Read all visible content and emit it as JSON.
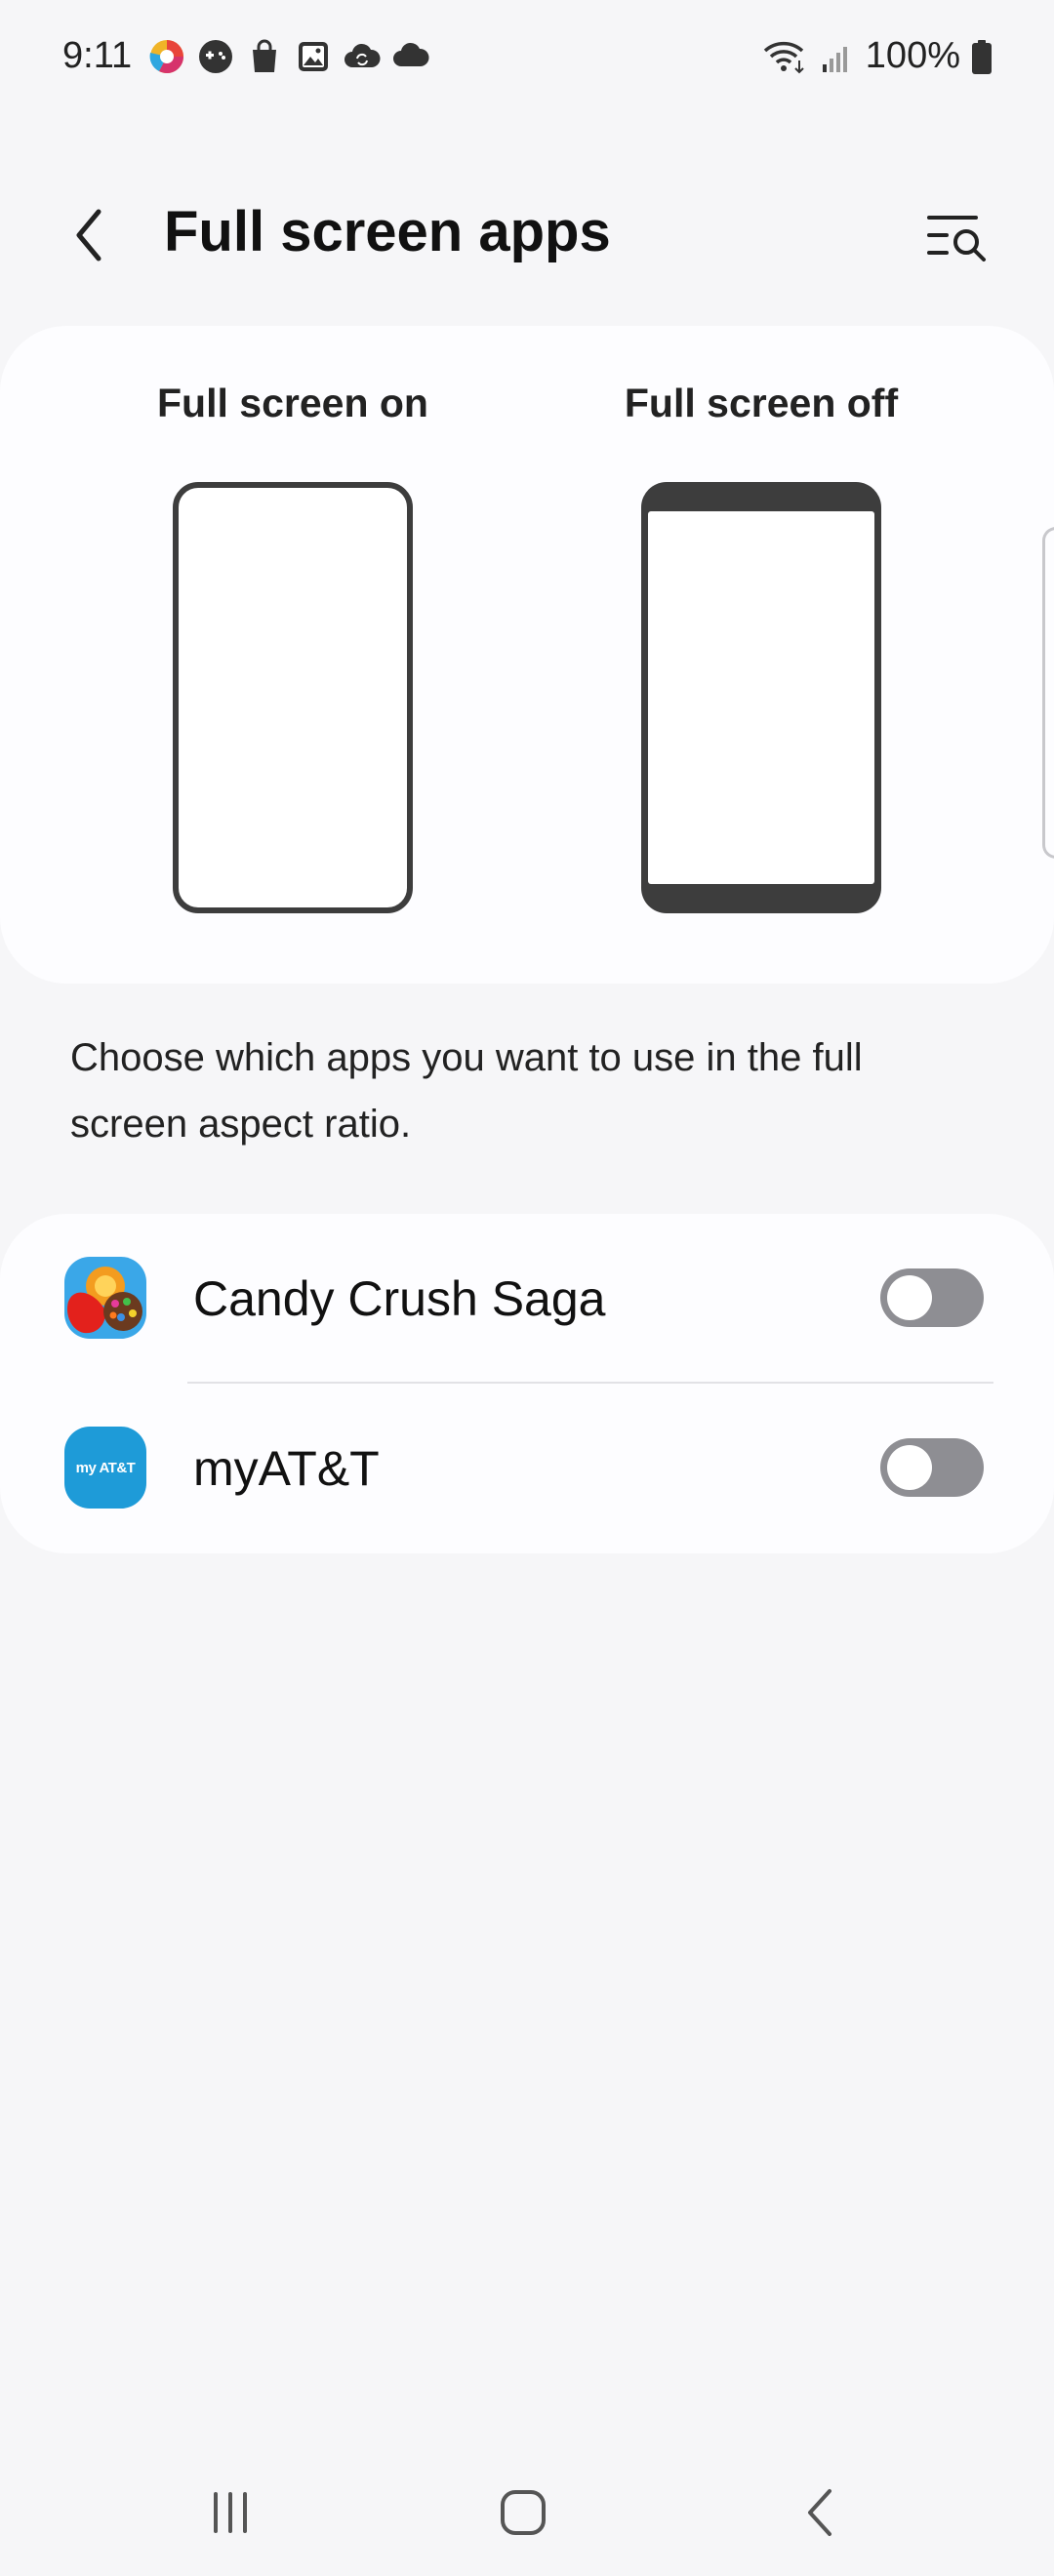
{
  "status_bar": {
    "time": "9:11",
    "battery": "100%",
    "left_icons": [
      "chrome-like-app-icon",
      "game-controller-icon",
      "shopping-bag-icon",
      "gallery-icon",
      "cloud-sync-icon",
      "cloud-icon"
    ],
    "right_icons": [
      "wifi-icon",
      "signal-icon",
      "battery-icon"
    ]
  },
  "header": {
    "title": "Full screen apps",
    "back_icon": "chevron-left-icon",
    "search_icon": "list-search-icon"
  },
  "illustration": {
    "on_label": "Full screen on",
    "off_label": "Full screen off"
  },
  "description": "Choose which apps you want to use in the full screen aspect ratio.",
  "apps": [
    {
      "name": "Candy Crush Saga",
      "enabled": false
    },
    {
      "name": "myAT&T",
      "enabled": false,
      "icon_text": "my AT&T"
    }
  ],
  "nav_bar": {
    "recents_icon": "recents-icon",
    "home_icon": "home-icon",
    "back_icon": "back-icon"
  },
  "colors": {
    "background": "#f6f6f8",
    "card": "#fdfdff",
    "toggle_off": "#8e8e93",
    "att_blue": "#1e9bd8"
  }
}
